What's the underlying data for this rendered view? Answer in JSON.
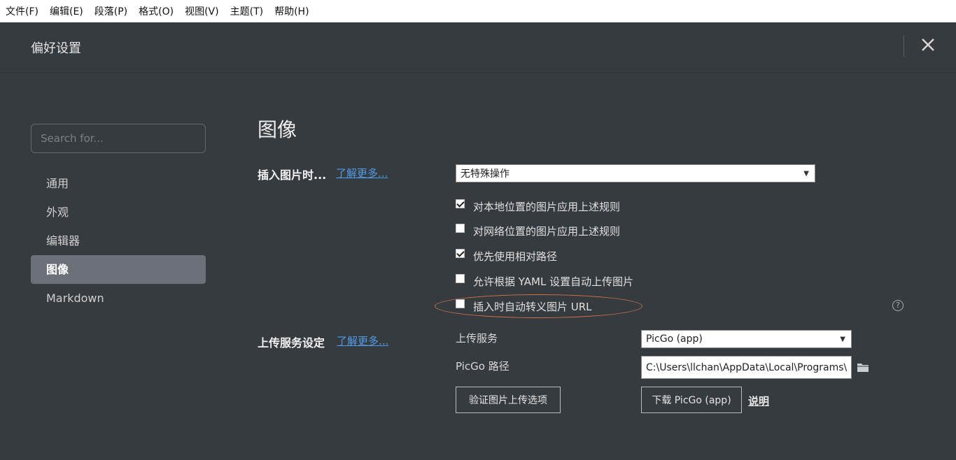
{
  "menubar": {
    "items": [
      "文件(F)",
      "编辑(E)",
      "段落(P)",
      "格式(O)",
      "视图(V)",
      "主题(T)",
      "帮助(H)"
    ]
  },
  "header": {
    "title": "偏好设置",
    "close_icon": "close-icon"
  },
  "sidebar": {
    "search_placeholder": "Search for...",
    "items": [
      {
        "label": "通用"
      },
      {
        "label": "外观"
      },
      {
        "label": "编辑器"
      },
      {
        "label": "图像",
        "active": true
      },
      {
        "label": "Markdown"
      }
    ]
  },
  "main": {
    "section_title": "图像",
    "insert": {
      "label": "插入图片时...",
      "learn_more": "了解更多...",
      "select_value": "无特殊操作",
      "options": [
        {
          "label": "对本地位置的图片应用上述规则",
          "checked": true
        },
        {
          "label": "对网络位置的图片应用上述规则",
          "checked": false
        },
        {
          "label": "优先使用相对路径",
          "checked": true
        },
        {
          "label": "允许根据 YAML 设置自动上传图片",
          "checked": false
        },
        {
          "label": "插入时自动转义图片 URL",
          "checked": false
        }
      ],
      "highlight_color": "#d0714a"
    },
    "upload": {
      "label": "上传服务设定",
      "learn_more": "了解更多...",
      "service_label": "上传服务",
      "service_value": "PicGo (app)",
      "path_label": "PicGo 路径",
      "path_value": "C:\\Users\\llchan\\AppData\\Local\\Programs\\PicGo\\PicGo.exe",
      "verify_button": "验证图片上传选项",
      "download_button": "下载 PicGo (app)",
      "explain_link": "说明"
    }
  },
  "colors": {
    "background": "#363b40",
    "link": "#4f9be8",
    "active_item": "#6c7078"
  }
}
